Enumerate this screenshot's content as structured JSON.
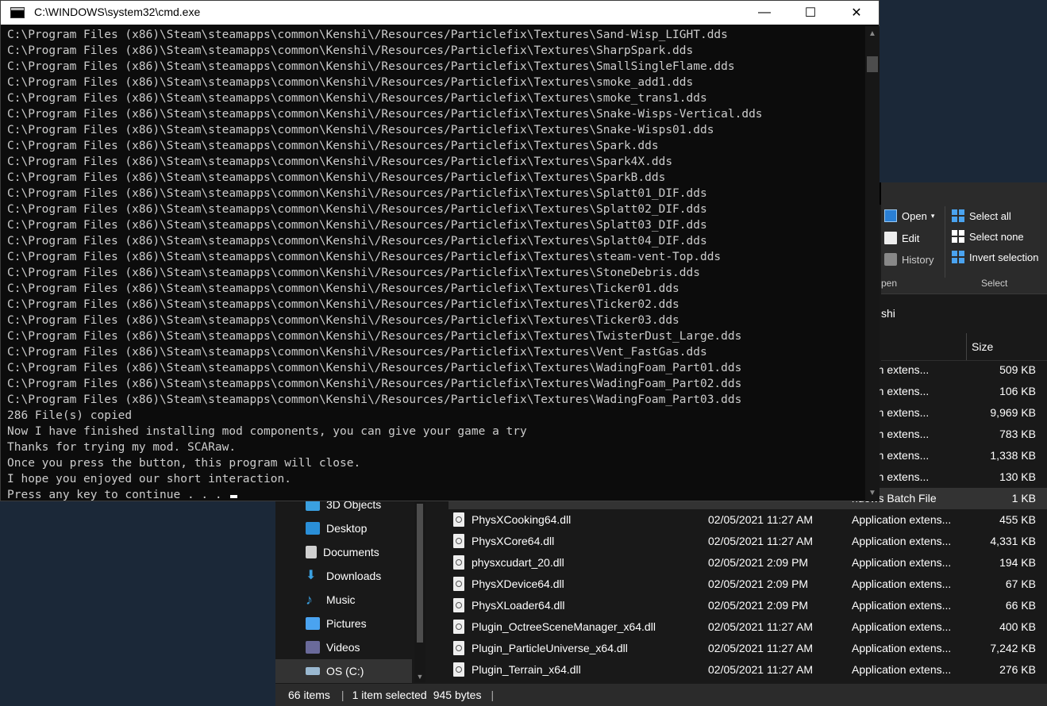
{
  "cmd": {
    "title": "C:\\WINDOWS\\system32\\cmd.exe",
    "minimize": "—",
    "maximize": "☐",
    "close": "✕",
    "lines": [
      "C:\\Program Files (x86)\\Steam\\steamapps\\common\\Kenshi\\/Resources/Particlefix\\Textures\\Sand-Wisp_LIGHT.dds",
      "C:\\Program Files (x86)\\Steam\\steamapps\\common\\Kenshi\\/Resources/Particlefix\\Textures\\SharpSpark.dds",
      "C:\\Program Files (x86)\\Steam\\steamapps\\common\\Kenshi\\/Resources/Particlefix\\Textures\\SmallSingleFlame.dds",
      "C:\\Program Files (x86)\\Steam\\steamapps\\common\\Kenshi\\/Resources/Particlefix\\Textures\\smoke_add1.dds",
      "C:\\Program Files (x86)\\Steam\\steamapps\\common\\Kenshi\\/Resources/Particlefix\\Textures\\smoke_trans1.dds",
      "C:\\Program Files (x86)\\Steam\\steamapps\\common\\Kenshi\\/Resources/Particlefix\\Textures\\Snake-Wisps-Vertical.dds",
      "C:\\Program Files (x86)\\Steam\\steamapps\\common\\Kenshi\\/Resources/Particlefix\\Textures\\Snake-Wisps01.dds",
      "C:\\Program Files (x86)\\Steam\\steamapps\\common\\Kenshi\\/Resources/Particlefix\\Textures\\Spark.dds",
      "C:\\Program Files (x86)\\Steam\\steamapps\\common\\Kenshi\\/Resources/Particlefix\\Textures\\Spark4X.dds",
      "C:\\Program Files (x86)\\Steam\\steamapps\\common\\Kenshi\\/Resources/Particlefix\\Textures\\SparkB.dds",
      "C:\\Program Files (x86)\\Steam\\steamapps\\common\\Kenshi\\/Resources/Particlefix\\Textures\\Splatt01_DIF.dds",
      "C:\\Program Files (x86)\\Steam\\steamapps\\common\\Kenshi\\/Resources/Particlefix\\Textures\\Splatt02_DIF.dds",
      "C:\\Program Files (x86)\\Steam\\steamapps\\common\\Kenshi\\/Resources/Particlefix\\Textures\\Splatt03_DIF.dds",
      "C:\\Program Files (x86)\\Steam\\steamapps\\common\\Kenshi\\/Resources/Particlefix\\Textures\\Splatt04_DIF.dds",
      "C:\\Program Files (x86)\\Steam\\steamapps\\common\\Kenshi\\/Resources/Particlefix\\Textures\\steam-vent-Top.dds",
      "C:\\Program Files (x86)\\Steam\\steamapps\\common\\Kenshi\\/Resources/Particlefix\\Textures\\StoneDebris.dds",
      "C:\\Program Files (x86)\\Steam\\steamapps\\common\\Kenshi\\/Resources/Particlefix\\Textures\\Ticker01.dds",
      "C:\\Program Files (x86)\\Steam\\steamapps\\common\\Kenshi\\/Resources/Particlefix\\Textures\\Ticker02.dds",
      "C:\\Program Files (x86)\\Steam\\steamapps\\common\\Kenshi\\/Resources/Particlefix\\Textures\\Ticker03.dds",
      "C:\\Program Files (x86)\\Steam\\steamapps\\common\\Kenshi\\/Resources/Particlefix\\Textures\\TwisterDust_Large.dds",
      "C:\\Program Files (x86)\\Steam\\steamapps\\common\\Kenshi\\/Resources/Particlefix\\Textures\\Vent_FastGas.dds",
      "C:\\Program Files (x86)\\Steam\\steamapps\\common\\Kenshi\\/Resources/Particlefix\\Textures\\WadingFoam_Part01.dds",
      "C:\\Program Files (x86)\\Steam\\steamapps\\common\\Kenshi\\/Resources/Particlefix\\Textures\\WadingFoam_Part02.dds",
      "C:\\Program Files (x86)\\Steam\\steamapps\\common\\Kenshi\\/Resources/Particlefix\\Textures\\WadingFoam_Part03.dds",
      "286 File(s) copied",
      "Now I have finished installing mod components, you can give your game a try",
      "Thanks for trying my mod. SCARaw.",
      "Once you press the button, this program will close.",
      "I hope you enjoyed our short interaction.",
      "Press any key to continue . . . "
    ]
  },
  "explorer": {
    "ribbon": {
      "open": "Open",
      "edit": "Edit",
      "history": "History",
      "open_group": "pen",
      "select_all": "Select all",
      "select_none": "Select none",
      "invert_selection": "Invert selection",
      "select_group": "Select"
    },
    "address_fragment": "shi",
    "size_header": "Size",
    "nav": [
      {
        "label": "3D Objects",
        "color": "#3aa0e0"
      },
      {
        "label": "Desktop",
        "color": "#2a8fd8"
      },
      {
        "label": "Documents",
        "color": "#d0d0d0"
      },
      {
        "label": "Downloads",
        "color": "#3aa0e0"
      },
      {
        "label": "Music",
        "color": "#3aa0e0"
      },
      {
        "label": "Pictures",
        "color": "#4aa3f0"
      },
      {
        "label": "Videos",
        "color": "#6a6a9a"
      },
      {
        "label": "OS (C:)",
        "color": "#9ab8d0"
      }
    ],
    "partial_rows": [
      {
        "type": "ication extens...",
        "size": "509 KB"
      },
      {
        "type": "ication extens...",
        "size": "106 KB"
      },
      {
        "type": "ication extens...",
        "size": "9,969 KB"
      },
      {
        "type": "ication extens...",
        "size": "783 KB"
      },
      {
        "type": "ication extens...",
        "size": "1,338 KB"
      },
      {
        "type": "ication extens...",
        "size": "130 KB"
      }
    ],
    "selected_row": {
      "type": "ndows Batch File",
      "size": "1 KB"
    },
    "rows": [
      {
        "name": "PhysXCooking64.dll",
        "date": "02/05/2021 11:27 AM",
        "type": "Application extens...",
        "size": "455 KB"
      },
      {
        "name": "PhysXCore64.dll",
        "date": "02/05/2021 11:27 AM",
        "type": "Application extens...",
        "size": "4,331 KB"
      },
      {
        "name": "physxcudart_20.dll",
        "date": "02/05/2021 2:09 PM",
        "type": "Application extens...",
        "size": "194 KB"
      },
      {
        "name": "PhysXDevice64.dll",
        "date": "02/05/2021 2:09 PM",
        "type": "Application extens...",
        "size": "67 KB"
      },
      {
        "name": "PhysXLoader64.dll",
        "date": "02/05/2021 2:09 PM",
        "type": "Application extens...",
        "size": "66 KB"
      },
      {
        "name": "Plugin_OctreeSceneManager_x64.dll",
        "date": "02/05/2021 11:27 AM",
        "type": "Application extens...",
        "size": "400 KB"
      },
      {
        "name": "Plugin_ParticleUniverse_x64.dll",
        "date": "02/05/2021 11:27 AM",
        "type": "Application extens...",
        "size": "7,242 KB"
      },
      {
        "name": "Plugin_Terrain_x64.dll",
        "date": "02/05/2021 11:27 AM",
        "type": "Application extens...",
        "size": "276 KB"
      }
    ],
    "status": {
      "items": "66 items",
      "selected": "1 item selected",
      "size": "945 bytes"
    }
  }
}
